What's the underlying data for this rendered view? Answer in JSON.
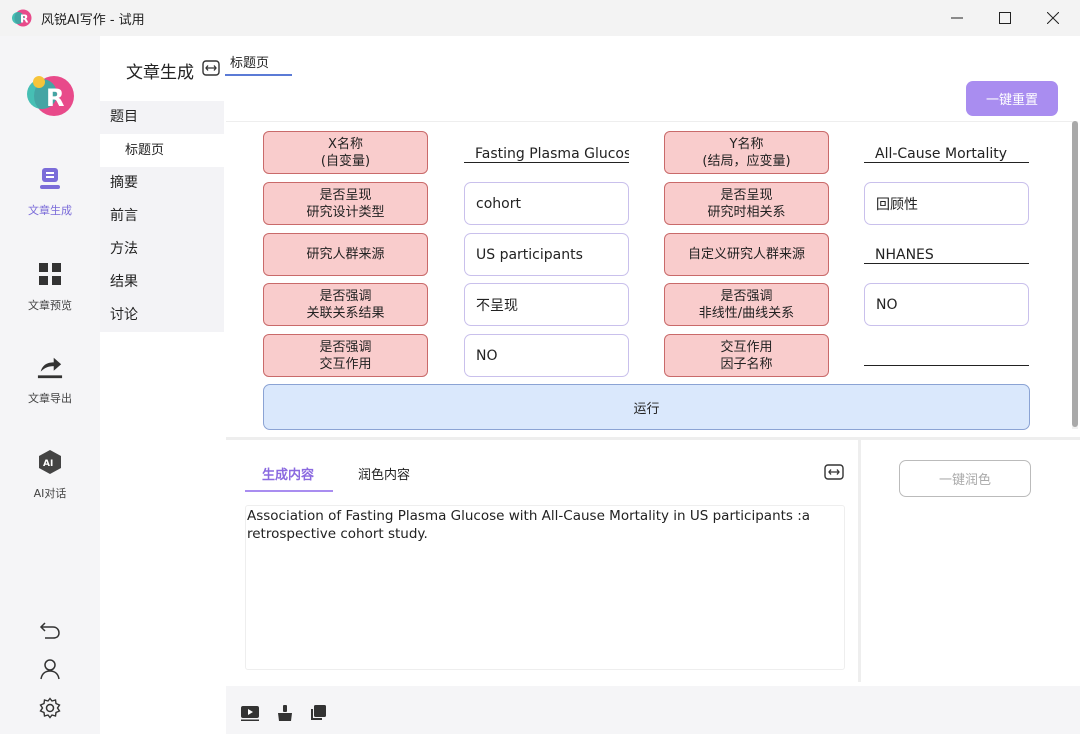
{
  "window": {
    "title": "风锐AI写作 - 试用",
    "minimize_glyph": "—",
    "maximize_glyph": "☐",
    "close_glyph": "✕"
  },
  "rail": {
    "items": [
      {
        "label": "文章生成",
        "icon": "document-icon",
        "active": true
      },
      {
        "label": "文章预览",
        "icon": "grid-icon",
        "active": false
      },
      {
        "label": "文章导出",
        "icon": "share-icon",
        "active": false
      },
      {
        "label": "AI对话",
        "icon": "ai-chat-icon",
        "active": false
      }
    ],
    "bottom_icons": [
      "back-icon",
      "user-icon",
      "gear-icon"
    ]
  },
  "sidebar": {
    "header": "文章生成",
    "items": [
      "题目",
      "标题页",
      "摘要",
      "前言",
      "方法",
      "结果",
      "讨论"
    ]
  },
  "top_tab": "标题页",
  "reset_button": "一键重置",
  "form": {
    "rows": [
      {
        "left_label": [
          "X名称",
          "(自变量)"
        ],
        "left_value": "Fasting Plasma Glucose",
        "left_style": "line",
        "right_label": [
          "Y名称",
          "(结局，应变量)"
        ],
        "right_value": "All-Cause Mortality",
        "right_style": "line"
      },
      {
        "left_label": [
          "是否呈现",
          "研究设计类型"
        ],
        "left_value": "cohort",
        "left_style": "box",
        "right_label": [
          "是否呈现",
          "研究时相关系"
        ],
        "right_value": "回顾性",
        "right_style": "box"
      },
      {
        "left_label": [
          "研究人群来源"
        ],
        "left_value": "US participants",
        "left_style": "box",
        "right_label": [
          "自定义研究人群来源"
        ],
        "right_value": "NHANES",
        "right_style": "line"
      },
      {
        "left_label": [
          "是否强调",
          "关联关系结果"
        ],
        "left_value": "不呈现",
        "left_style": "box",
        "right_label": [
          "是否强调",
          "非线性/曲线关系"
        ],
        "right_value": "NO",
        "right_style": "box"
      },
      {
        "left_label": [
          "是否强调",
          "交互作用"
        ],
        "left_value": "NO",
        "left_style": "box",
        "right_label": [
          "交互作用",
          "因子名称"
        ],
        "right_value": "",
        "right_style": "line"
      }
    ],
    "run_button": "运行"
  },
  "output": {
    "tabs": [
      "生成内容",
      "润色内容"
    ],
    "content": "Association of Fasting Plasma Glucose with All-Cause Mortality in US participants :a retrospective cohort study.",
    "polish_button": "一键润色"
  },
  "colors": {
    "accent": "#a98df0",
    "label_fill": "#f9cccc",
    "label_border": "#c96a6a",
    "run_fill": "#dae8fc"
  }
}
